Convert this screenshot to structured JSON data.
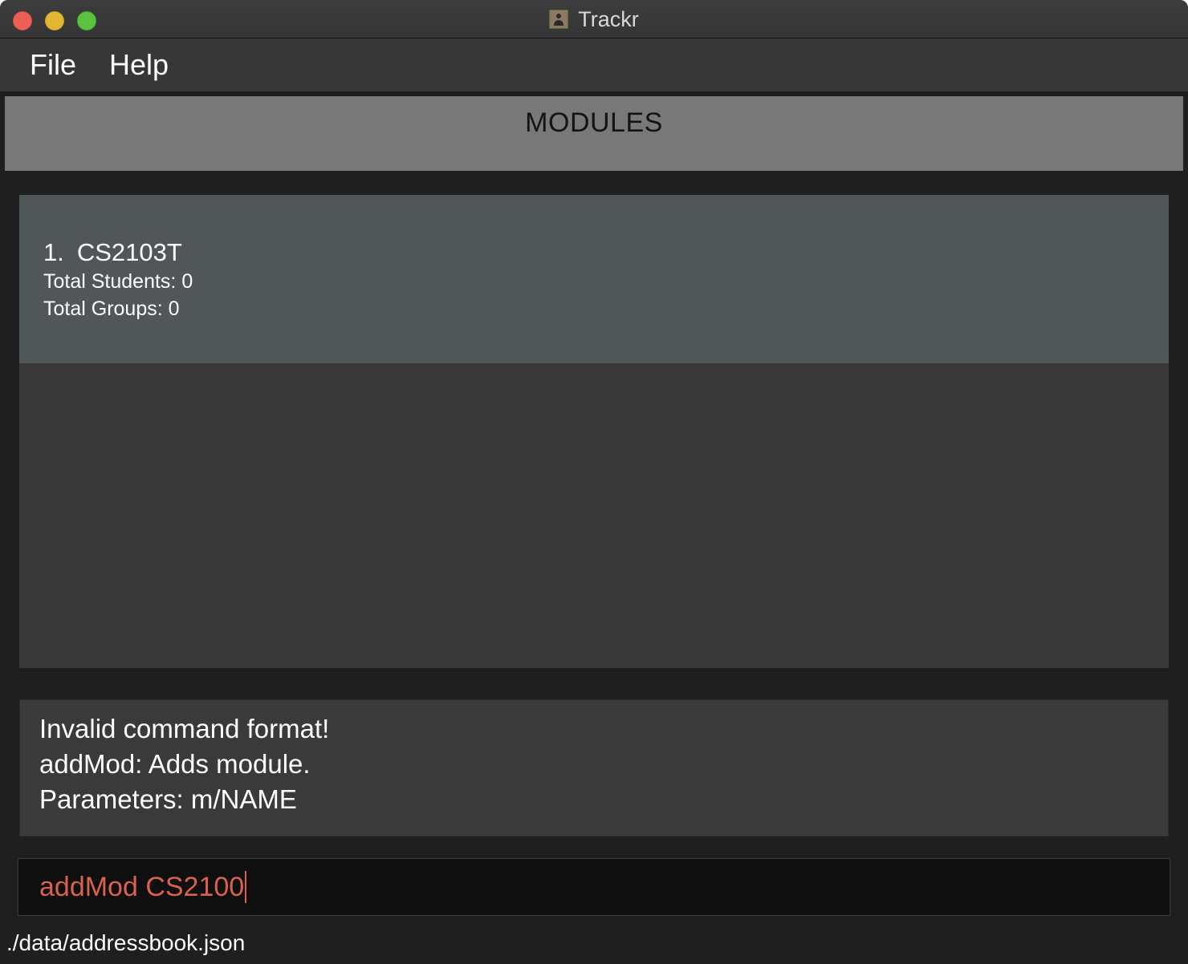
{
  "window": {
    "title": "Trackr"
  },
  "menu": {
    "items": [
      {
        "label": "File"
      },
      {
        "label": "Help"
      }
    ]
  },
  "header": {
    "title": "MODULES"
  },
  "modules": [
    {
      "index": "1.",
      "code": "CS2103T",
      "total_students": "Total Students: 0",
      "total_groups": "Total Groups: 0"
    }
  ],
  "result": {
    "lines": [
      "Invalid command format!",
      "addMod: Adds module.",
      "Parameters: m/NAME"
    ]
  },
  "command": {
    "value": "addMod CS2100",
    "text_color": "#d9624c"
  },
  "status": {
    "file_path": "./data/addressbook.json"
  },
  "colors": {
    "window_bg": "#1f1f1f",
    "header_bg": "#787878",
    "card_bg": "#515658",
    "list_bg": "#383838",
    "command_bg": "#0f0f0f"
  }
}
